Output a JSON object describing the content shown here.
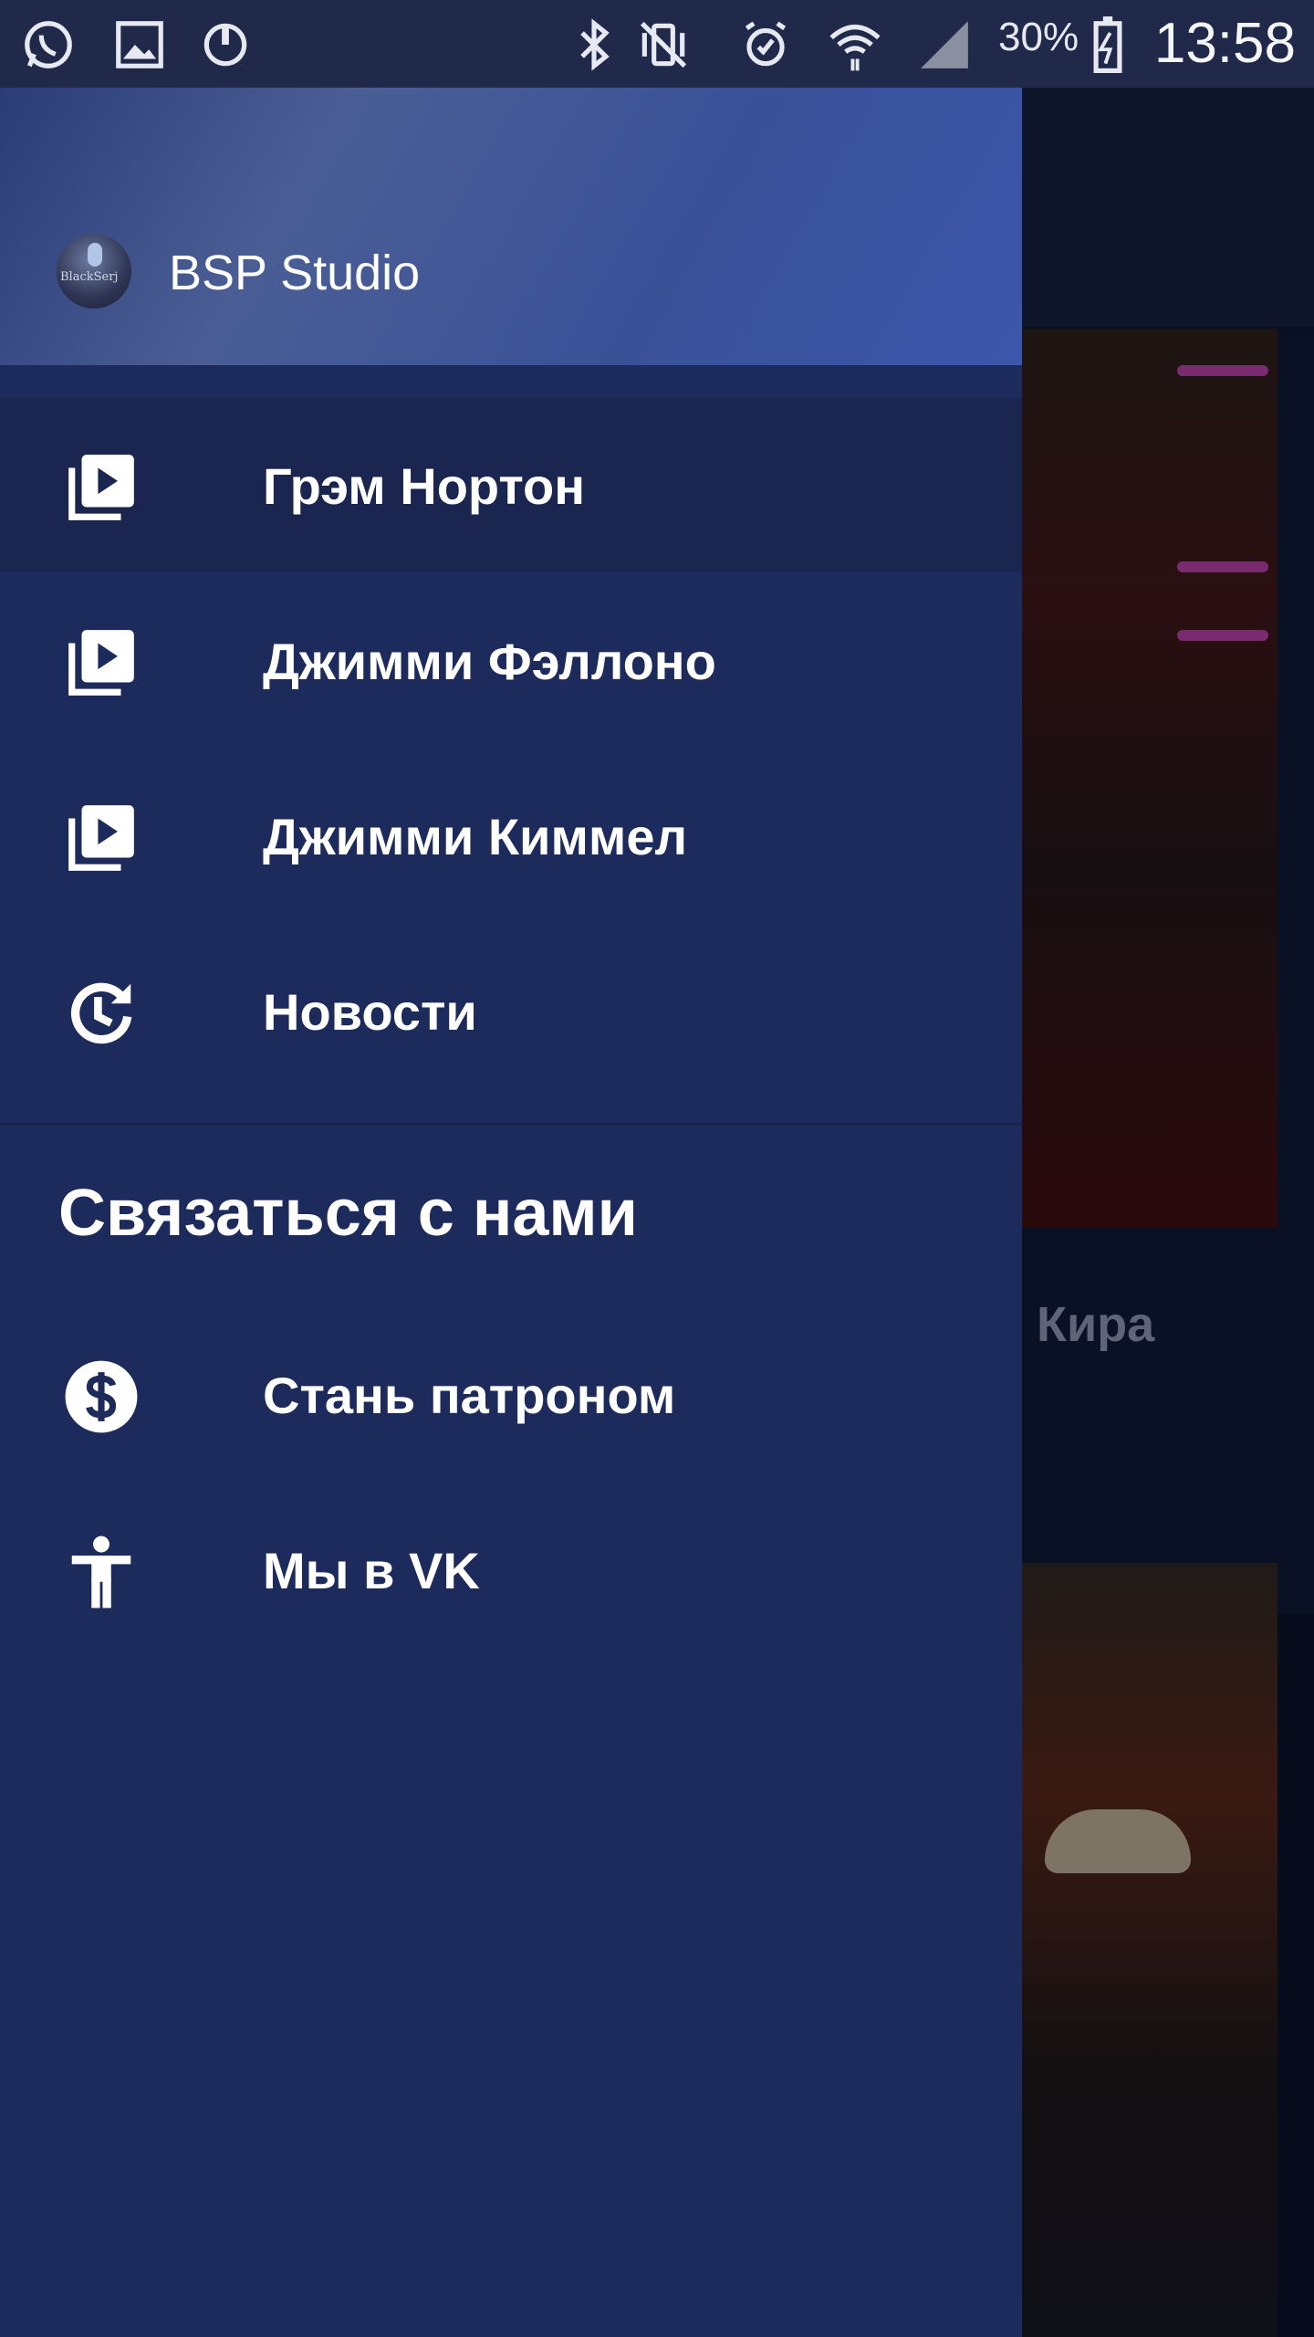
{
  "status_bar": {
    "battery": "30%",
    "time": "13:58",
    "icons": [
      "whatsapp-icon",
      "gallery-icon",
      "sync-icon",
      "bluetooth-icon",
      "vibrate-icon",
      "alarm-icon",
      "wifi-icon",
      "signal-icon",
      "battery-icon"
    ]
  },
  "drawer": {
    "app_name": "BSP Studio",
    "avatar_text": "BlackSerj",
    "items": [
      {
        "label": "Грэм Нортон",
        "icon": "play-library-icon",
        "active": true
      },
      {
        "label": "Джимми Фэллоно",
        "icon": "play-library-icon",
        "active": false
      },
      {
        "label": "Джимми Киммел",
        "icon": "play-library-icon",
        "active": false
      },
      {
        "label": "Новости",
        "icon": "history-icon",
        "active": false
      }
    ],
    "section_title": "Связаться с нами",
    "contact_items": [
      {
        "label": "Стань патроном",
        "icon": "dollar-icon"
      },
      {
        "label": "Мы в VK",
        "icon": "person-icon"
      }
    ]
  },
  "background": {
    "card_title": "Кира"
  },
  "colors": {
    "drawer_bg": "#1d2b5c",
    "active_item_bg": "#1a2650",
    "header_gradient_end": "#3b57ab"
  }
}
